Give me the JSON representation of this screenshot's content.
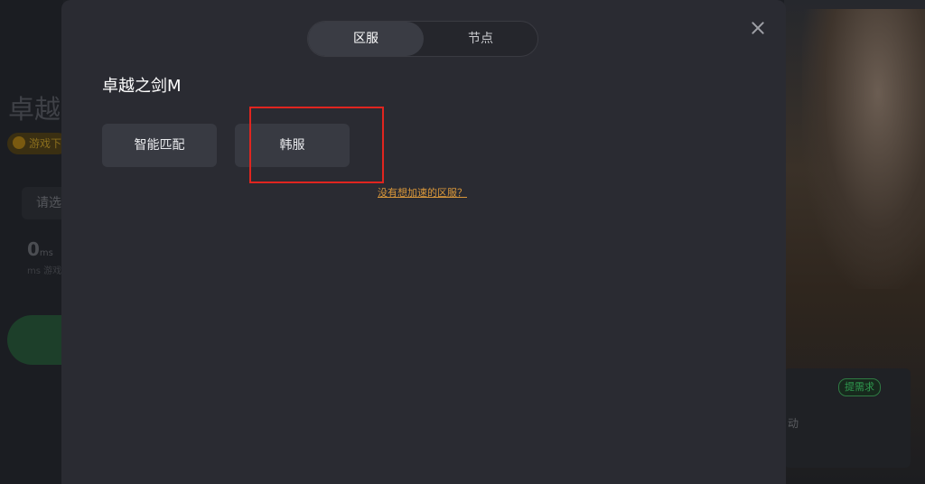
{
  "background": {
    "title": "卓越之",
    "badge": "游戏下",
    "select_label": "请选",
    "ping_value": "0",
    "ping_unit": "ms",
    "ping_label": "ms 游戏延",
    "tag": "提需求",
    "side_text": "动"
  },
  "modal": {
    "tabs": [
      {
        "label": "区服",
        "active": true
      },
      {
        "label": "节点",
        "active": false
      }
    ],
    "game_title": "卓越之剑M",
    "options": [
      {
        "label": "智能匹配"
      },
      {
        "label": "韩服"
      }
    ],
    "missing_link": "没有想加速的区服？",
    "highlight_color": "#e0251f",
    "link_color": "#d9973a"
  }
}
